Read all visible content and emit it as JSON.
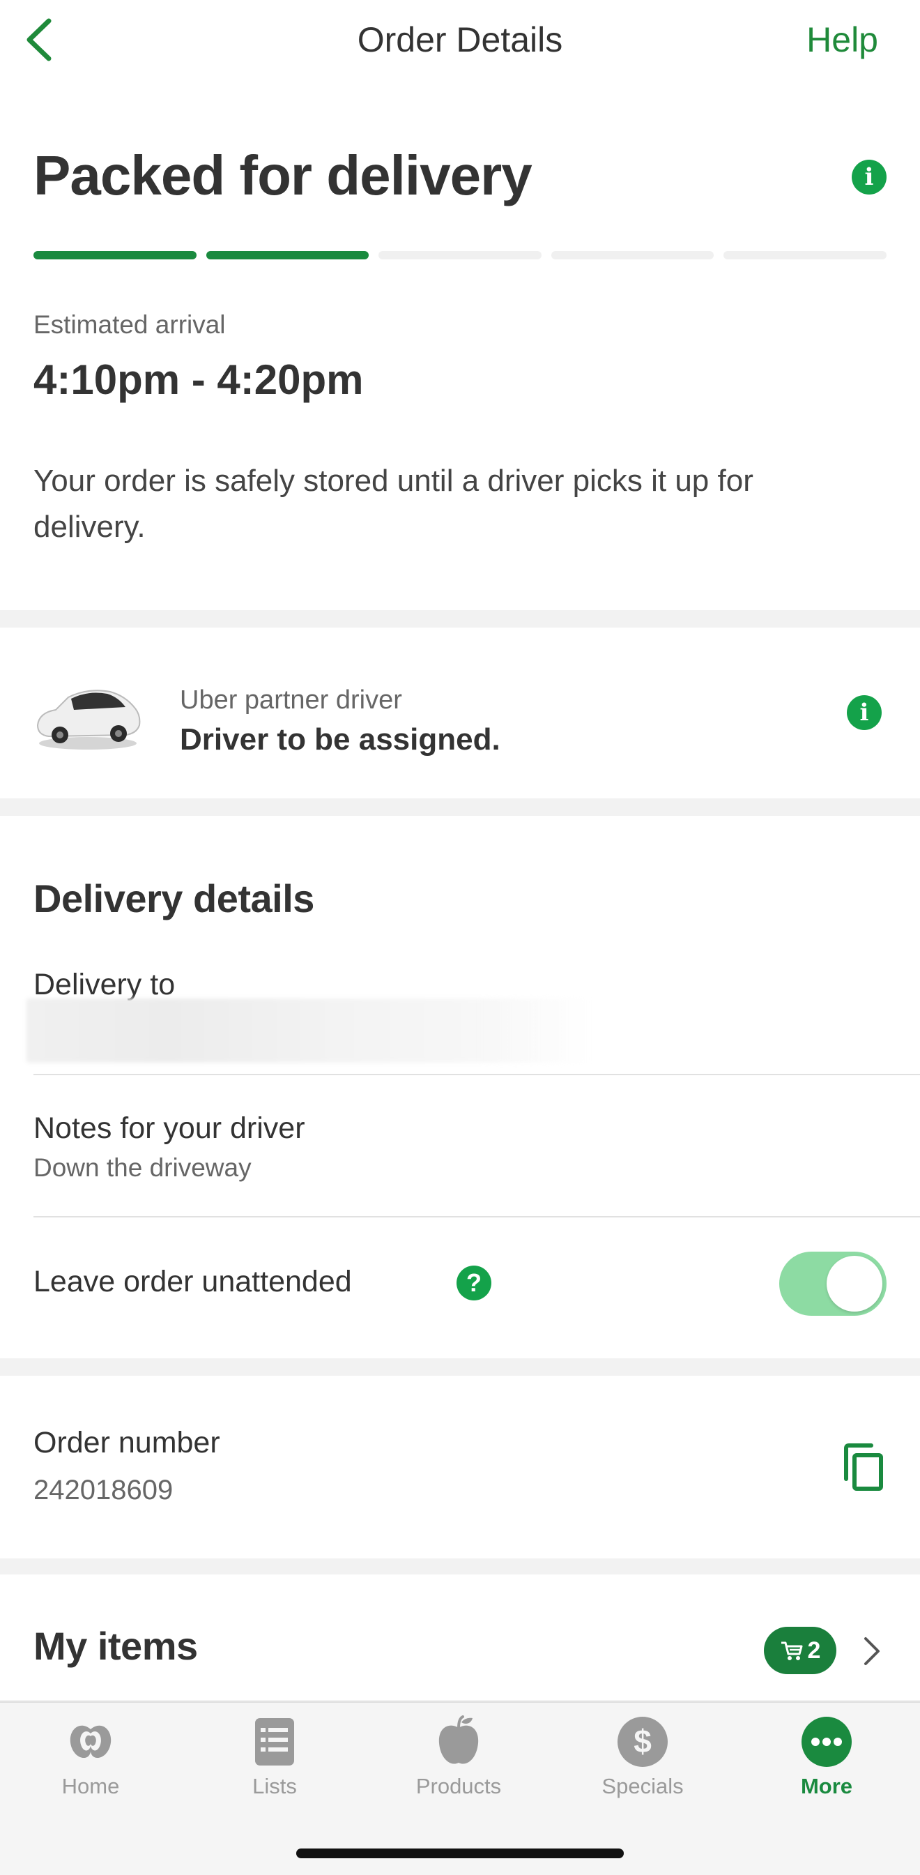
{
  "nav": {
    "title": "Order Details",
    "help_label": "Help"
  },
  "status": {
    "title": "Packed for delivery",
    "progress_steps_completed": 2,
    "progress_steps_total": 5,
    "eta_label": "Estimated arrival",
    "eta_value": "4:10pm - 4:20pm",
    "message": "Your order is safely stored until a driver picks it up for delivery."
  },
  "driver": {
    "label": "Uber partner driver",
    "status": "Driver to be assigned."
  },
  "delivery": {
    "title": "Delivery details",
    "delivery_to_label": "Delivery to",
    "notes_label": "Notes for your driver",
    "notes_value": "Down the driveway",
    "unattended_label": "Leave order unattended",
    "unattended_on": true
  },
  "order": {
    "number_label": "Order number",
    "number_value": "242018609"
  },
  "items": {
    "title": "My items",
    "count": "2"
  },
  "tabbar": {
    "tabs": [
      {
        "label": "Home",
        "icon": "woolworths-logo-icon",
        "active": false
      },
      {
        "label": "Lists",
        "icon": "list-icon",
        "active": false
      },
      {
        "label": "Products",
        "icon": "apple-icon",
        "active": false
      },
      {
        "label": "Specials",
        "icon": "dollar-icon",
        "active": false
      },
      {
        "label": "More",
        "icon": "more-dots-icon",
        "active": true
      }
    ]
  },
  "colors": {
    "accent": "#1a8a3f",
    "info": "#14a24a",
    "toggle_on": "#8ddba3",
    "badge": "#1a7f3c"
  }
}
